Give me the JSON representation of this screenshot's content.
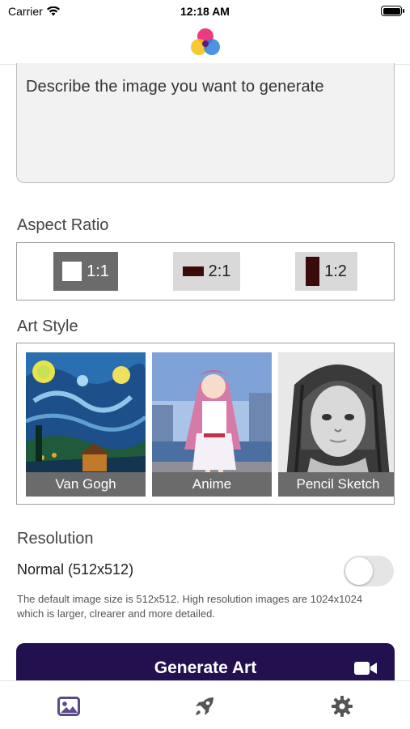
{
  "status_bar": {
    "carrier": "Carrier",
    "time": "12:18 AM"
  },
  "prompt": {
    "placeholder": "Describe the image you want to generate"
  },
  "aspect_ratio": {
    "title": "Aspect Ratio",
    "options": [
      {
        "label": "1:1",
        "selected": true
      },
      {
        "label": "2:1",
        "selected": false
      },
      {
        "label": "1:2",
        "selected": false
      }
    ]
  },
  "art_style": {
    "title": "Art Style",
    "styles": [
      {
        "label": "Van Gogh"
      },
      {
        "label": "Anime"
      },
      {
        "label": "Pencil Sketch"
      }
    ]
  },
  "resolution": {
    "title": "Resolution",
    "option_label": "Normal (512x512)",
    "enabled": false,
    "description": "The default image size is 512x512. High resolution images are 1024x1024 which is larger, clrearer and more detailed."
  },
  "generate": {
    "label": "Generate Art",
    "icon": "video-camera-icon"
  },
  "tabs": [
    {
      "icon": "image-gallery-icon",
      "active": true
    },
    {
      "icon": "rocket-icon",
      "active": false
    },
    {
      "icon": "gear-icon",
      "active": false
    }
  ],
  "colors": {
    "primary": "#22104f",
    "selected_option": "#6b6b6b",
    "unselected_option": "#d9d9d9",
    "active_tab": "#5b4a8a",
    "inactive_tab": "#555555"
  }
}
